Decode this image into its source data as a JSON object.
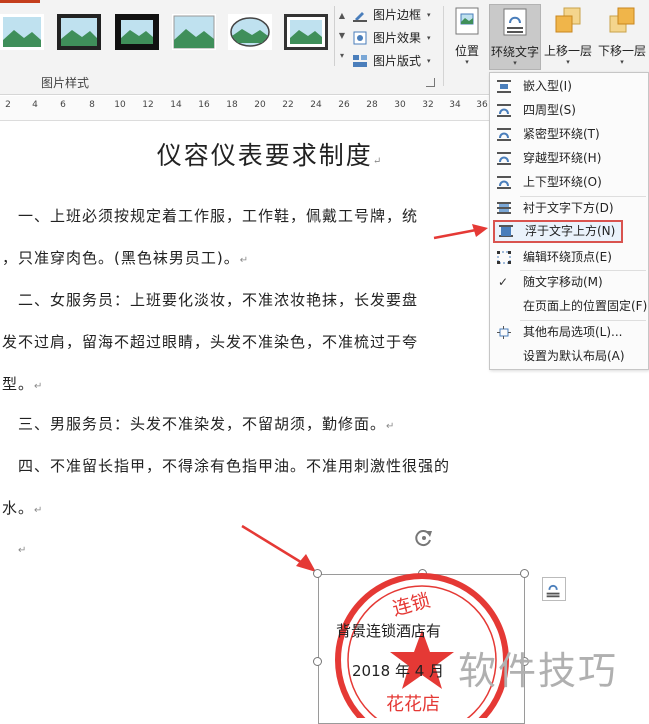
{
  "ribbon": {
    "picture_styles_label": "图片样式",
    "picture_border": "图片边框",
    "picture_effects": "图片效果",
    "picture_layout": "图片版式",
    "position": "位置",
    "wrap_text": "环绕文字",
    "bring_forward": "上移一层",
    "send_backward": "下移一层",
    "dropdown_glyph": "▾"
  },
  "ruler": {
    "ticks": [
      "2",
      "4",
      "6",
      "8",
      "10",
      "12",
      "14",
      "16",
      "18",
      "20",
      "22",
      "24",
      "26",
      "28",
      "30",
      "32",
      "34",
      "36"
    ]
  },
  "document": {
    "title": "仪容仪表要求制度",
    "para_mark": "↵",
    "lines": [
      "一、上班必须按规定着工作服，工作鞋，佩戴工号牌，统",
      "，只准穿肉色。(黑色袜男员工)。",
      "二、女服务员：上班要化淡妆，不准浓妆艳抹，长发要盘",
      "发不过肩，留海不超过眼睛，头发不准染色，不准梳过于夸",
      "型。",
      "三、男服务员：头发不准染发，不留胡须，勤修面。",
      "四、不准留长指甲，不得涂有色指甲油。不准用刺激性很强的",
      "水。"
    ]
  },
  "wrap_menu": {
    "items": [
      {
        "label": "嵌入型(I)",
        "icon": "inline-wrap-icon"
      },
      {
        "label": "四周型(S)",
        "icon": "square-wrap-icon"
      },
      {
        "label": "紧密型环绕(T)",
        "icon": "tight-wrap-icon"
      },
      {
        "label": "穿越型环绕(H)",
        "icon": "through-wrap-icon"
      },
      {
        "label": "上下型环绕(O)",
        "icon": "top-bottom-wrap-icon"
      },
      {
        "label": "衬于文字下方(D)",
        "icon": "behind-text-icon"
      },
      {
        "label": "浮于文字上方(N)",
        "icon": "in-front-of-text-icon"
      },
      {
        "label": "编辑环绕顶点(E)",
        "icon": "edit-wrap-points-icon"
      },
      {
        "label": "随文字移动(M)",
        "icon": "check-icon"
      },
      {
        "label": "在页面上的位置固定(F)",
        "icon": ""
      },
      {
        "label": "其他布局选项(L)...",
        "icon": "more-layout-icon"
      },
      {
        "label": "设置为默认布局(A)",
        "icon": ""
      }
    ],
    "checked_glyph": "✓"
  },
  "stamp": {
    "seal_text": "连锁",
    "line1": "背景连锁酒店有",
    "line2": "2018 年 4 月",
    "footer": "花花店"
  },
  "watermark": "软件技巧",
  "colors": {
    "accent_red": "#e53935",
    "highlight_border": "#d9534f",
    "active_button": "#c9c9c9"
  }
}
